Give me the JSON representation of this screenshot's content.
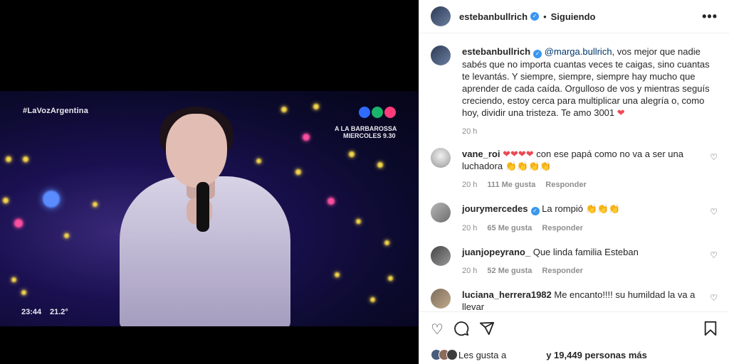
{
  "video": {
    "hashtag": "#LaVozArgentina",
    "promo_line1": "A LA BARBAROSSA",
    "promo_line2": "MIERCOLES 9.30",
    "clock": "23:44",
    "temperature": "21.2°",
    "logo_colors": [
      "#2f6bff",
      "#19b56b",
      "#ff3b7a"
    ]
  },
  "header": {
    "username": "estebanbullrich",
    "separator": "•",
    "follow_status": "Siguiendo",
    "more": "•••"
  },
  "caption": {
    "username": "estebanbullrich",
    "mention": "@marga.bullrich",
    "text": ", vos mejor que nadie sabés que no importa cuantas veces te caigas, sino cuantas te levantás. Y siempre, siempre, siempre hay mucho que aprender de cada caída. Orgulloso de vos y mientras seguís creciendo, estoy cerca para multiplicar una alegría o, como hoy, dividir una tristeza. Te amo 3001",
    "emoji": "❤",
    "time": "20 h"
  },
  "comments": [
    {
      "username": "vane_roi",
      "emoji_pre": "❤❤❤❤",
      "text": " con ese papá como no va a ser una luchadora ",
      "emoji_post": "👏👏👏👏",
      "time": "20 h",
      "likes": "111 Me gusta",
      "reply": "Responder"
    },
    {
      "username": "jourymercedes",
      "text": "La rompió ",
      "emoji_post": "👏👏👏",
      "time": "20 h",
      "likes": "65 Me gusta",
      "reply": "Responder"
    },
    {
      "username": "juanjopeyrano_",
      "text": "Que linda familia Esteban",
      "time": "20 h",
      "likes": "52 Me gusta",
      "reply": "Responder"
    },
    {
      "username": "luciana_herrera1982",
      "text": "Me encanto!!!! su humildad la va a llevar",
      "time": "",
      "likes": "",
      "reply": ""
    }
  ],
  "footer": {
    "likes_prefix": "Les gusta a",
    "likes_suffix": "y 19,449 personas más"
  }
}
